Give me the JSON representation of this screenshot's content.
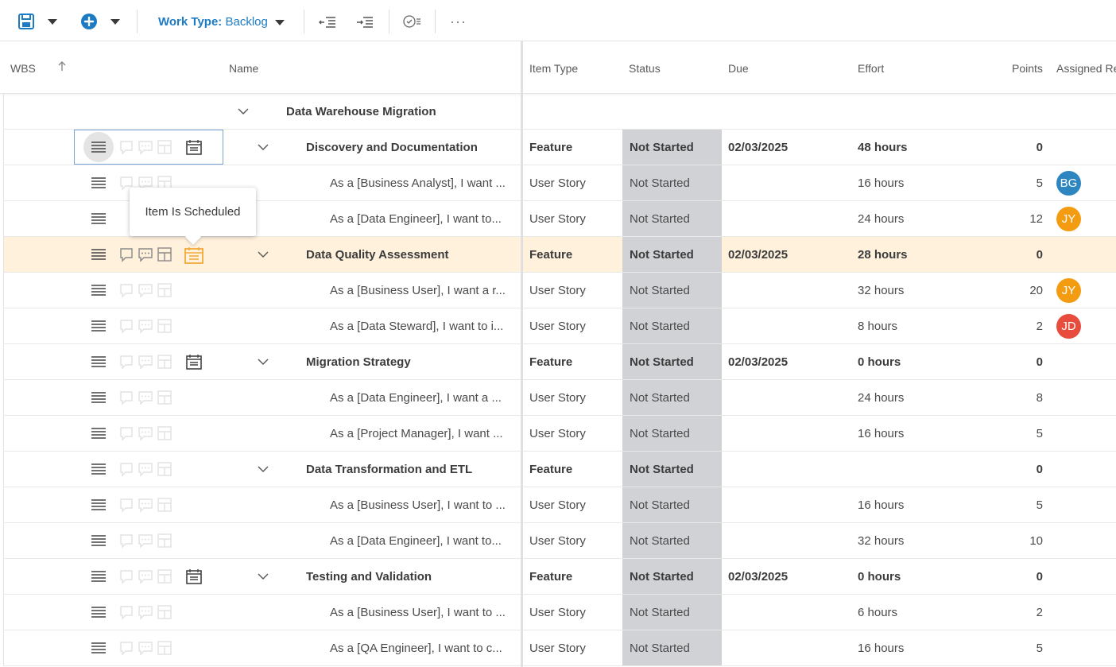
{
  "toolbar": {
    "work_type_label": "Work Type:",
    "work_type_value": "Backlog",
    "more_label": "···"
  },
  "header": {
    "wbs": "WBS",
    "name": "Name",
    "item_type": "Item Type",
    "status": "Status",
    "due": "Due",
    "effort": "Effort",
    "points": "Points",
    "assigned": "Assigned Re"
  },
  "tooltip": "Item Is Scheduled",
  "group": {
    "name": "Data Warehouse Migration"
  },
  "rows": [
    {
      "name": "Discovery and Documentation",
      "type": "Feature",
      "status": "Not Started",
      "due": "02/03/2025",
      "effort": "48 hours",
      "points": "0",
      "assignee": ""
    },
    {
      "name": "As a [Business Analyst], I want ...",
      "type": "User Story",
      "status": "Not Started",
      "due": "",
      "effort": "16 hours",
      "points": "5",
      "assignee": "BG"
    },
    {
      "name": "As a [Data Engineer], I want to...",
      "type": "User Story",
      "status": "Not Started",
      "due": "",
      "effort": "24 hours",
      "points": "12",
      "assignee": "JY"
    },
    {
      "name": "Data Quality Assessment",
      "type": "Feature",
      "status": "Not Started",
      "due": "02/03/2025",
      "effort": "28 hours",
      "points": "0",
      "assignee": ""
    },
    {
      "name": "As a [Business User], I want a r...",
      "type": "User Story",
      "status": "Not Started",
      "due": "",
      "effort": "32 hours",
      "points": "20",
      "assignee": "JY"
    },
    {
      "name": "As a [Data Steward], I want to i...",
      "type": "User Story",
      "status": "Not Started",
      "due": "",
      "effort": "8 hours",
      "points": "2",
      "assignee": "JD"
    },
    {
      "name": "Migration Strategy",
      "type": "Feature",
      "status": "Not Started",
      "due": "02/03/2025",
      "effort": "0 hours",
      "points": "0",
      "assignee": ""
    },
    {
      "name": "As a [Data Engineer], I want a ...",
      "type": "User Story",
      "status": "Not Started",
      "due": "",
      "effort": "24 hours",
      "points": "8",
      "assignee": ""
    },
    {
      "name": "As a [Project Manager], I want ...",
      "type": "User Story",
      "status": "Not Started",
      "due": "",
      "effort": "16 hours",
      "points": "5",
      "assignee": ""
    },
    {
      "name": "Data Transformation and ETL",
      "type": "Feature",
      "status": "Not Started",
      "due": "",
      "effort": "",
      "points": "0",
      "assignee": ""
    },
    {
      "name": "As a [Business User], I want to ...",
      "type": "User Story",
      "status": "Not Started",
      "due": "",
      "effort": "16 hours",
      "points": "5",
      "assignee": ""
    },
    {
      "name": "As a [Data Engineer], I want to...",
      "type": "User Story",
      "status": "Not Started",
      "due": "",
      "effort": "32 hours",
      "points": "10",
      "assignee": ""
    },
    {
      "name": "Testing and Validation",
      "type": "Feature",
      "status": "Not Started",
      "due": "02/03/2025",
      "effort": "0 hours",
      "points": "0",
      "assignee": ""
    },
    {
      "name": "As a [Business User], I want to ...",
      "type": "User Story",
      "status": "Not Started",
      "due": "",
      "effort": "6 hours",
      "points": "2",
      "assignee": ""
    },
    {
      "name": "As a [QA Engineer], I want to c...",
      "type": "User Story",
      "status": "Not Started",
      "due": "",
      "effort": "16 hours",
      "points": "5",
      "assignee": ""
    }
  ],
  "colors": {
    "accent": "#1d7bc3",
    "status_bg": "#d0d2d6",
    "highlight_row": "#fff1dc",
    "scheduled_icon": "#f2a93b",
    "avatar_BG": "#2e86c1",
    "avatar_JY": "#f39c12",
    "avatar_JD": "#e74c3c"
  }
}
